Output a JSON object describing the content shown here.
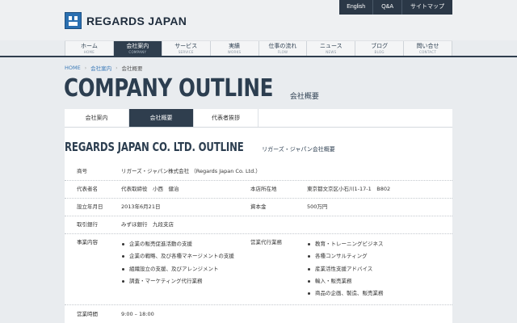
{
  "brand": {
    "name": "REGARDS JAPAN"
  },
  "utility": [
    "English",
    "Q&A",
    "サイトマップ"
  ],
  "gnav": [
    {
      "ja": "ホーム",
      "en": "HOME"
    },
    {
      "ja": "会社案内",
      "en": "COMPANY"
    },
    {
      "ja": "サービス",
      "en": "SERVICE"
    },
    {
      "ja": "実績",
      "en": "WORKS"
    },
    {
      "ja": "仕事の流れ",
      "en": "FLOW"
    },
    {
      "ja": "ニュース",
      "en": "NEWS"
    },
    {
      "ja": "ブログ",
      "en": "BLOG"
    },
    {
      "ja": "問い合せ",
      "en": "CONTACT"
    }
  ],
  "breadcrumb": {
    "home": "HOME",
    "parent": "会社案内",
    "current": "会社概要",
    "sep": "›"
  },
  "page_title": {
    "en": "COMPANY OUTLINE",
    "ja": "会社概要"
  },
  "tabs": [
    "会社案内",
    "会社概要",
    "代表者挨拶"
  ],
  "section": {
    "en": "REGARDS JAPAN CO. LTD. OUTLINE",
    "ja": "リガーズ・ジャパン会社概要"
  },
  "table": {
    "company_label": "商号",
    "company_value": "リガーズ・ジャパン株式会社 （Regards Japan Co. Ltd.）",
    "rep_label": "代表者名",
    "rep_value": "代表取締役　小西　健治",
    "hq_label": "本店所在地",
    "hq_value": "東京都文京区小石川1-17-1　B802",
    "founded_label": "設立年月日",
    "founded_value": "2013年6月21日",
    "capital_label": "資本金",
    "capital_value": "500万円",
    "bank_label": "取引銀行",
    "bank_value": "みずほ銀行　九段支店",
    "business_label": "事業内容",
    "business_items": [
      "企業の販売促進活動の支援",
      "企業の戦略、及び各種マネージメントの支援",
      "組織設立の支援、及びアレンジメント",
      "調査・マーケティング代行業務"
    ],
    "agency_label": "営業代行業務",
    "agency_items": [
      "教育・トレーニングビジネス",
      "各種コンサルティング",
      "産業活性支援アドバイス",
      "輸入・販売業務",
      "商品の企画、製造、販売業務"
    ],
    "hours_label": "営業時間",
    "hours_value": "9:00 – 18:00"
  }
}
